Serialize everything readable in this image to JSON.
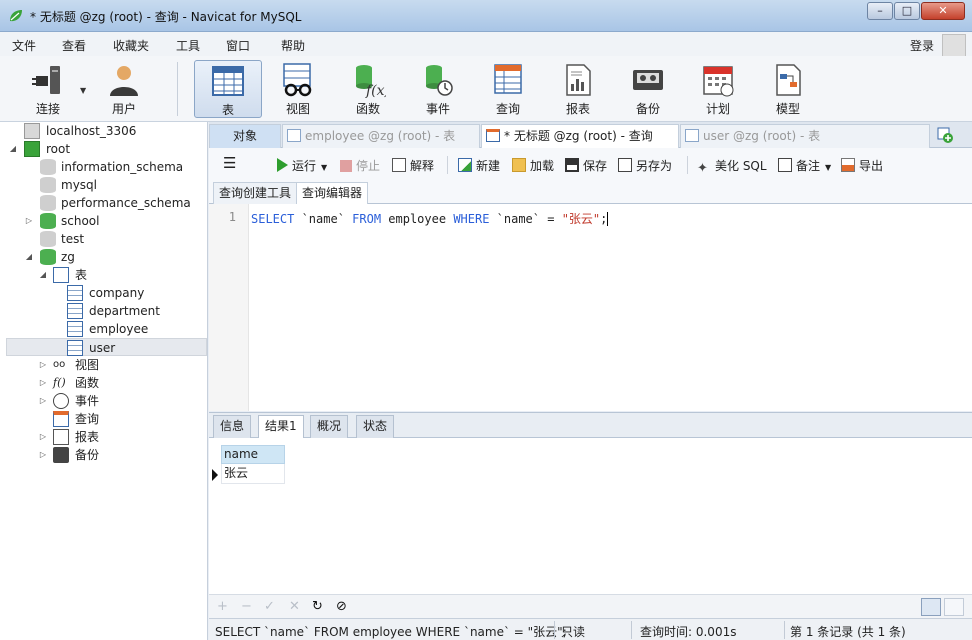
{
  "window": {
    "title": "* 无标题 @zg (root) - 查询 - Navicat for MySQL",
    "min": "–",
    "max": "□",
    "close": "✕"
  },
  "menu": [
    "文件",
    "查看",
    "收藏夹",
    "工具",
    "窗口",
    "帮助"
  ],
  "login": "登录",
  "toolbar": [
    {
      "id": "connect",
      "label": "连接"
    },
    {
      "id": "user",
      "label": "用户"
    },
    {
      "id": "table",
      "label": "表"
    },
    {
      "id": "view",
      "label": "视图"
    },
    {
      "id": "function",
      "label": "函数"
    },
    {
      "id": "event",
      "label": "事件"
    },
    {
      "id": "query",
      "label": "查询"
    },
    {
      "id": "report",
      "label": "报表"
    },
    {
      "id": "backup",
      "label": "备份"
    },
    {
      "id": "schedule",
      "label": "计划"
    },
    {
      "id": "model",
      "label": "模型"
    }
  ],
  "tree": {
    "conn1": "localhost_3306",
    "conn2": "root",
    "db_info": "information_schema",
    "db_mysql": "mysql",
    "db_perf": "performance_schema",
    "db_school": "school",
    "db_test": "test",
    "db_zg": "zg",
    "tables": "表",
    "t_company": "company",
    "t_department": "department",
    "t_employee": "employee",
    "t_user": "user",
    "views": "视图",
    "functions": "函数",
    "events": "事件",
    "queries": "查询",
    "reports": "报表",
    "backups": "备份"
  },
  "tabs": {
    "object": "对象",
    "employee": "employee @zg (root) - 表",
    "query": "* 无标题 @zg (root) - 查询",
    "user": "user @zg (root) - 表"
  },
  "qtoolbar": {
    "run": "运行",
    "stop": "停止",
    "explain": "解释",
    "new": "新建",
    "load": "加载",
    "save": "保存",
    "saveas": "另存为",
    "beautify": "美化 SQL",
    "note": "备注",
    "export": "导出"
  },
  "subtabs": {
    "builder": "查询创建工具",
    "editor": "查询编辑器"
  },
  "editor": {
    "line": "1",
    "kw_select": "SELECT",
    "col": " `name` ",
    "kw_from": "FROM",
    "tbl": " employee ",
    "kw_where": "WHERE",
    "cond": " `name` = ",
    "value": "\"张云\"",
    "end": ";"
  },
  "result_tabs": [
    "信息",
    "结果1",
    "概况",
    "状态"
  ],
  "result": {
    "column": "name",
    "value": "张云"
  },
  "gridbar": {
    "add": "+",
    "remove": "−",
    "apply": "✓",
    "discard": "✕",
    "refresh": "↻",
    "stop": "⊘"
  },
  "status": {
    "sql": "SELECT `name` FROM employee WHERE `name` = \"张云\";",
    "mode": "只读",
    "time": "查询时间: 0.001s",
    "records": "第 1 条记录 (共 1 条)"
  },
  "colors": {
    "keyword": "#2b5fd9",
    "string": "#c0392b",
    "accent": "#cfe6f5"
  }
}
